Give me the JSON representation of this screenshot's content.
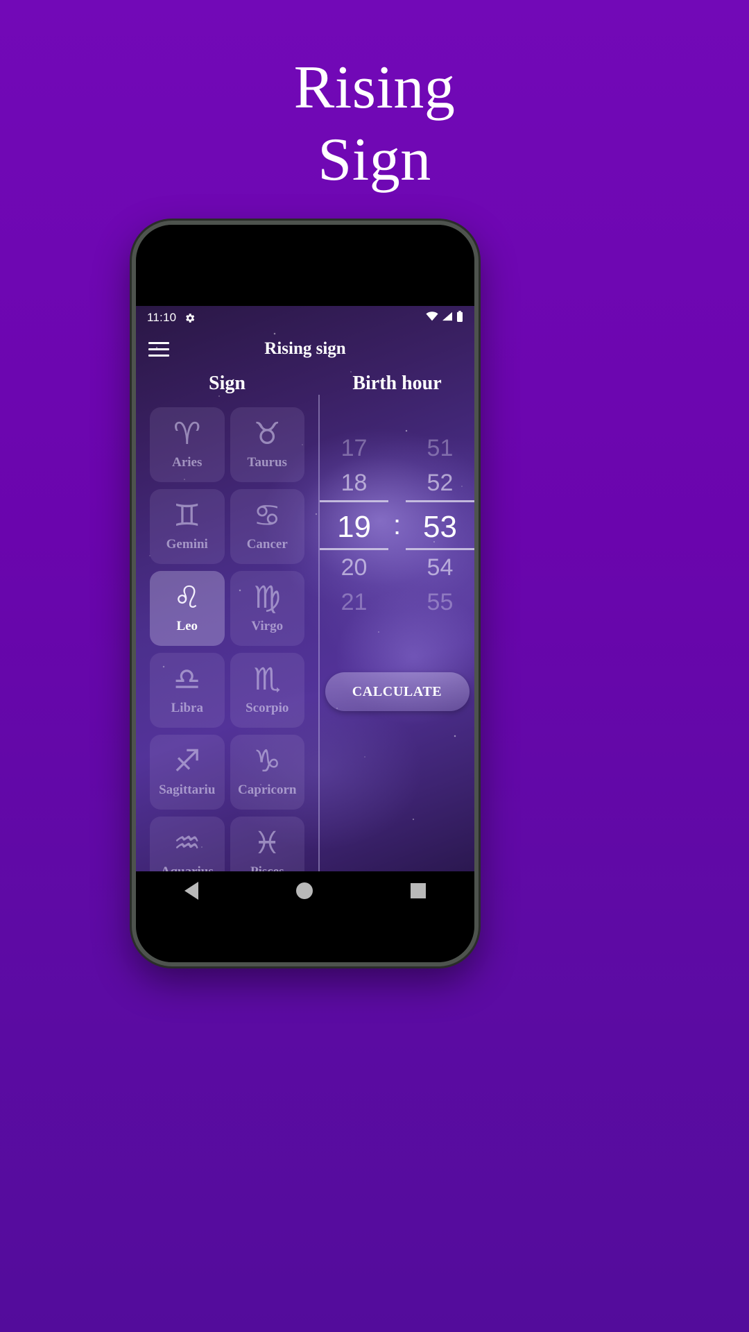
{
  "promo": {
    "title_line1": "Rising",
    "title_line2": "Sign",
    "background_color": "#7209b7"
  },
  "device": {
    "frame_color": "#4e534e",
    "accent_button_color": "#e8734a"
  },
  "statusbar": {
    "time": "11:10",
    "gear_icon": "gear-icon",
    "wifi_icon": "wifi-icon",
    "signal_icon": "signal-icon",
    "battery_icon": "battery-icon"
  },
  "appbar": {
    "menu_icon": "hamburger-menu-icon",
    "title": "Rising sign"
  },
  "columns": {
    "sign_header": "Sign",
    "birth_hour_header": "Birth hour"
  },
  "signs": [
    {
      "label": "Aries",
      "glyph": "♈",
      "selected": false
    },
    {
      "label": "Taurus",
      "glyph": "♉",
      "selected": false
    },
    {
      "label": "Gemini",
      "glyph": "♊",
      "selected": false
    },
    {
      "label": "Cancer",
      "glyph": "♋",
      "selected": false
    },
    {
      "label": "Leo",
      "glyph": "♌",
      "selected": true
    },
    {
      "label": "Virgo",
      "glyph": "♍",
      "selected": false
    },
    {
      "label": "Libra",
      "glyph": "♎",
      "selected": false
    },
    {
      "label": "Scorpio",
      "glyph": "♏",
      "selected": false
    },
    {
      "label": "Sagittariu",
      "glyph": "♐",
      "selected": false
    },
    {
      "label": "Capricorn",
      "glyph": "♑",
      "selected": false
    },
    {
      "label": "Aquarius",
      "glyph": "♒",
      "selected": false
    },
    {
      "label": "Pisces",
      "glyph": "♓",
      "selected": false
    }
  ],
  "time_picker": {
    "hours": {
      "above2": "17",
      "above1": "18",
      "selected": "19",
      "below1": "20",
      "below2": "21"
    },
    "separator": ":",
    "minutes": {
      "above2": "51",
      "above1": "52",
      "selected": "53",
      "below1": "54",
      "below2": "55"
    }
  },
  "calculate_button": {
    "label": "CALCULATE"
  },
  "navbar": {
    "back_icon": "back-triangle-icon",
    "home_icon": "home-circle-icon",
    "recents_icon": "recents-square-icon"
  }
}
